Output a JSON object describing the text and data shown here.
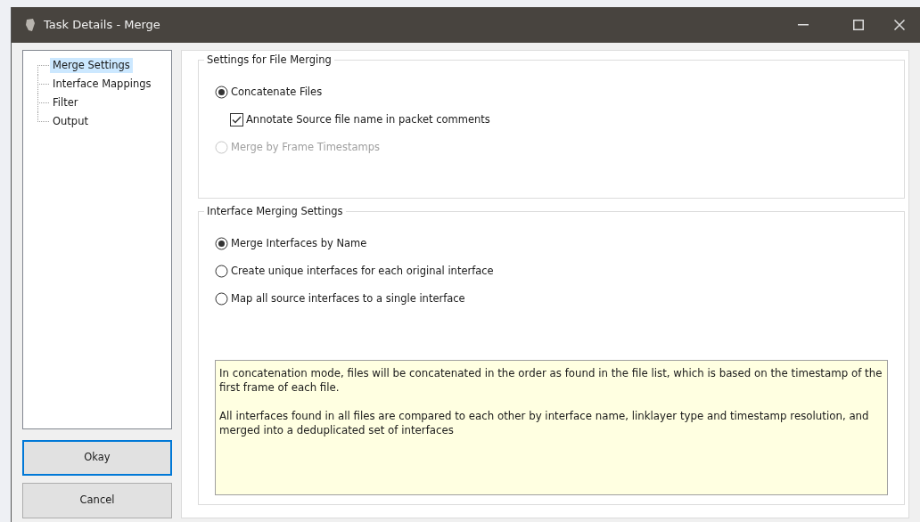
{
  "window": {
    "title": "Task Details - Merge"
  },
  "tree": {
    "items": [
      {
        "label": "Merge Settings",
        "selected": true
      },
      {
        "label": "Interface Mappings",
        "selected": false
      },
      {
        "label": "Filter",
        "selected": false
      },
      {
        "label": "Output",
        "selected": false
      }
    ]
  },
  "buttons": [
    {
      "label": "Okay",
      "default": true
    },
    {
      "label": "Cancel",
      "default": false
    }
  ],
  "groups": [
    {
      "title": "Settings for File Merging",
      "options": [
        {
          "kind": "radio",
          "label": "Concatenate Files",
          "selected": true,
          "disabled": false
        },
        {
          "kind": "checkbox",
          "label": "Annotate Source file name in packet comments",
          "checked": true,
          "disabled": false
        },
        {
          "kind": "radio",
          "label": "Merge by Frame Timestamps",
          "selected": false,
          "disabled": true
        }
      ]
    },
    {
      "title": "Interface Merging Settings",
      "options": [
        {
          "kind": "radio",
          "label": "Merge Interfaces by Name",
          "selected": true,
          "disabled": false
        },
        {
          "kind": "radio",
          "label": "Create unique interfaces for each original interface",
          "selected": false,
          "disabled": false
        },
        {
          "kind": "radio",
          "label": "Map all source interfaces to a single interface",
          "selected": false,
          "disabled": false
        }
      ],
      "note": [
        "In concatenation mode, files will be concatenated in the order as found in the file list, which is based on the timestamp of the first frame of each file.",
        "All interfaces found in all files are compared to each other by interface name, linklayer type and timestamp resolution, and merged into a deduplicated set of interfaces"
      ]
    }
  ]
}
